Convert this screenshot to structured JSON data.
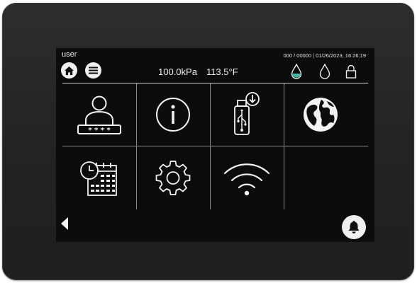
{
  "header": {
    "user": "user",
    "counter": "000 / 00000",
    "datetime": "01/26/2023, 16:26:19",
    "pressure": "100.0kPa",
    "temperature": "113.5°F"
  },
  "icons": {
    "home": "home-icon",
    "menu": "menu-icon",
    "water_drop_filled": "water-drop-filled-icon",
    "water_drop_outline": "water-drop-icon",
    "lock": "lock-icon",
    "back": "back-arrow-icon",
    "bell": "bell-icon"
  },
  "tiles": [
    {
      "name": "user-login",
      "icon": "user-password-icon"
    },
    {
      "name": "information",
      "icon": "info-icon"
    },
    {
      "name": "usb-export",
      "icon": "usb-download-icon"
    },
    {
      "name": "language",
      "icon": "globe-icon"
    },
    {
      "name": "schedule",
      "icon": "calendar-clock-icon"
    },
    {
      "name": "settings",
      "icon": "gear-icon"
    },
    {
      "name": "wifi",
      "icon": "wifi-icon"
    },
    {
      "name": "empty",
      "icon": ""
    }
  ],
  "colors": {
    "screen_bg": "#0c0c0c",
    "device_bezel": "#262626",
    "accent_teal": "#3fb8a8",
    "icon_white": "#f2f2f2"
  }
}
